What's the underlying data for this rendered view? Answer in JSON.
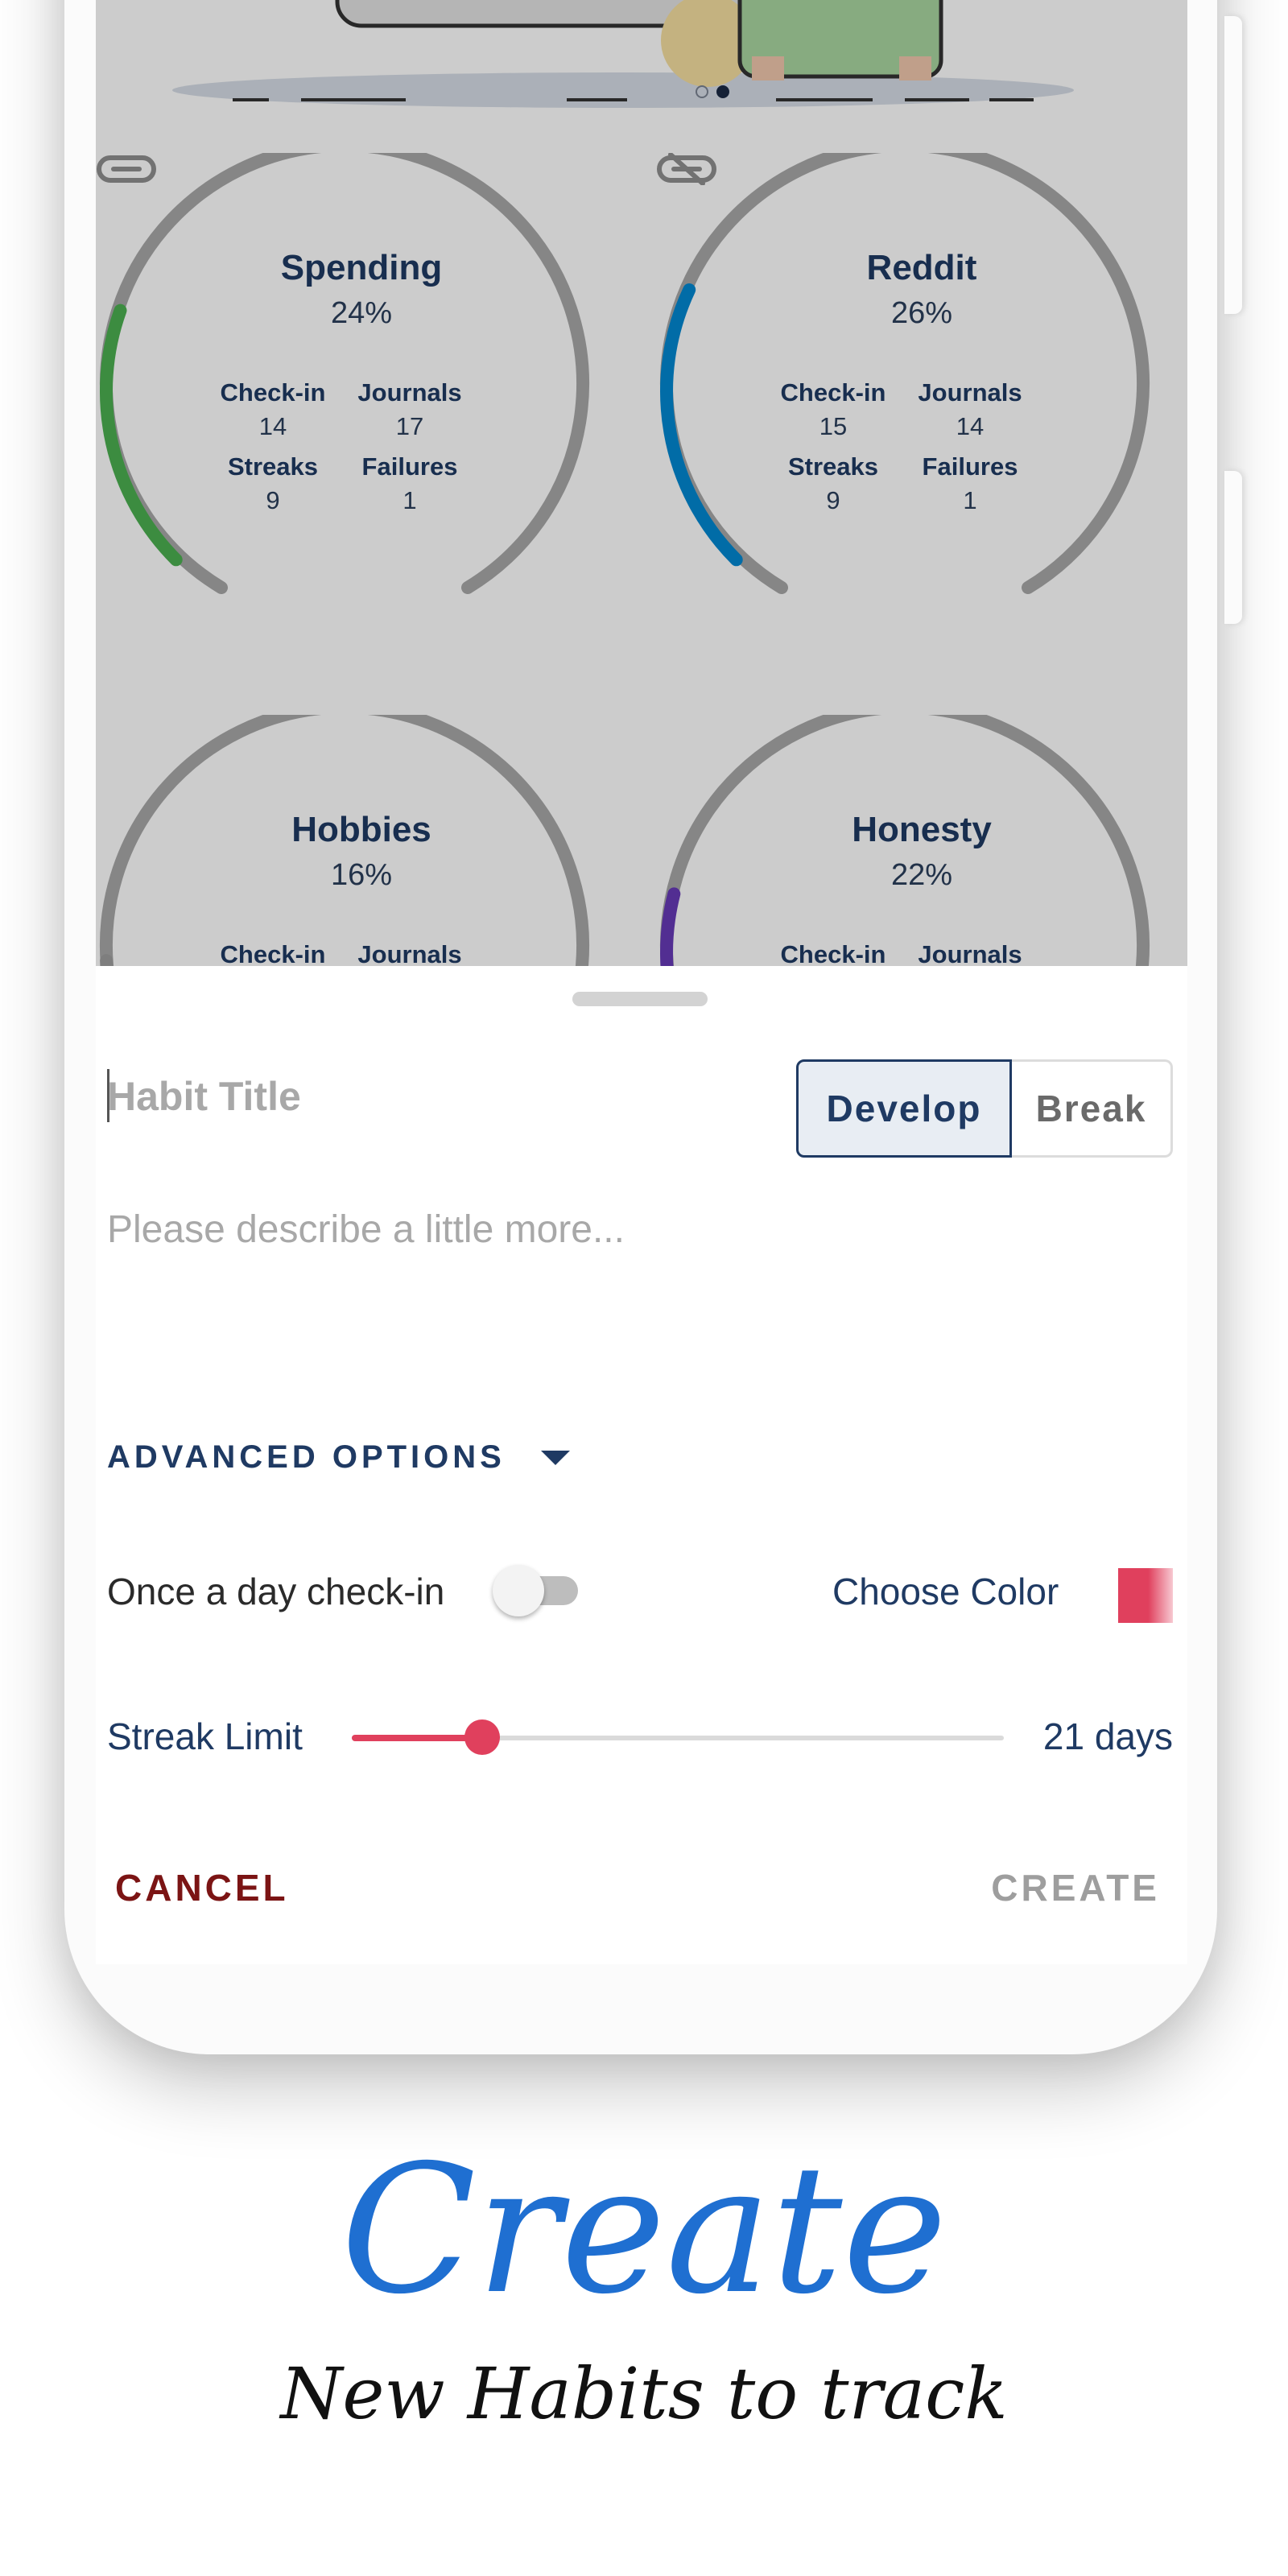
{
  "carousel": {
    "count": 2,
    "active_index": 1
  },
  "habits": [
    {
      "title": "Spending",
      "percent": "24%",
      "progress": 0.24,
      "color": "#4caf50",
      "stats": {
        "checkin_label": "Check-in",
        "checkin": "14",
        "journals_label": "Journals",
        "journals": "17",
        "streaks_label": "Streaks",
        "streaks": "9",
        "failures_label": "Failures",
        "failures": "1"
      },
      "icon": "link-icon"
    },
    {
      "title": "Reddit",
      "percent": "26%",
      "progress": 0.26,
      "color": "#0288d1",
      "stats": {
        "checkin_label": "Check-in",
        "checkin": "15",
        "journals_label": "Journals",
        "journals": "14",
        "streaks_label": "Streaks",
        "streaks": "9",
        "failures_label": "Failures",
        "failures": "1"
      },
      "icon": "link-off-icon"
    },
    {
      "title": "Hobbies",
      "percent": "16%",
      "progress": 0.16,
      "color": "#9e9e9e",
      "stats": {
        "checkin_label": "Check-in",
        "journals_label": "Journals"
      }
    },
    {
      "title": "Honesty",
      "percent": "22%",
      "progress": 0.22,
      "color": "#673ab7",
      "stats": {
        "checkin_label": "Check-in",
        "journals_label": "Journals"
      }
    }
  ],
  "form": {
    "title_placeholder": "Habit Title",
    "title_value": "",
    "type_develop": "Develop",
    "type_break": "Break",
    "selected_type": "Develop",
    "description_placeholder": "Please describe a little more...",
    "advanced_label": "ADVANCED OPTIONS",
    "once_label": "Once a day check-in",
    "once_enabled": false,
    "choose_color_label": "Choose Color",
    "selected_color": "#e0405d",
    "streak_label": "Streak Limit",
    "streak_value_text": "21 days",
    "streak_fraction": 0.2,
    "cancel_label": "CANCEL",
    "create_label": "CREATE"
  },
  "marketing": {
    "headline": "Create",
    "subline": "New Habits to track"
  },
  "colors": {
    "navy": "#1f3a63",
    "accent": "#e0405d",
    "cancel": "#7b1414",
    "headline": "#1f6fd1"
  }
}
